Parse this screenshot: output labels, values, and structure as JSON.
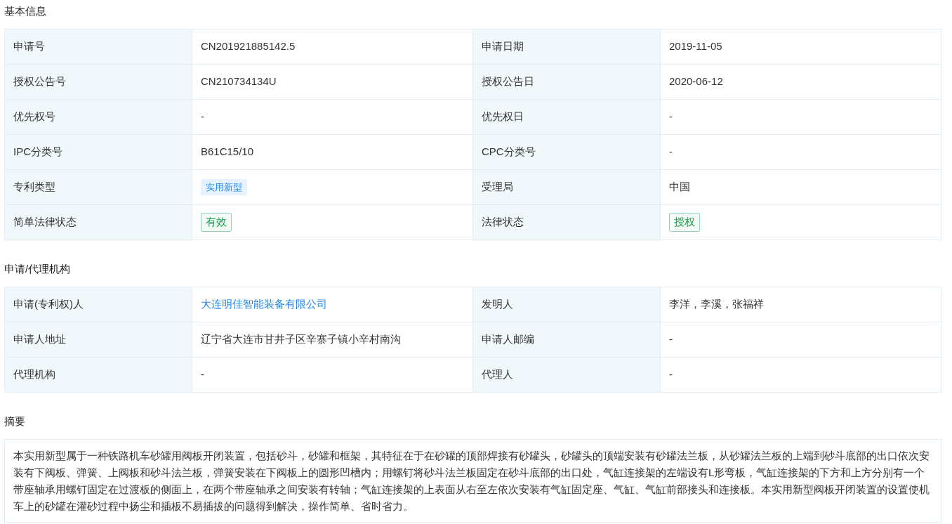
{
  "sections": [
    {
      "title": "基本信息",
      "kind": "table",
      "rows": [
        [
          {
            "label": "申请号",
            "value": "CN201921885142.5",
            "kind": "text"
          },
          {
            "label": "申请日期",
            "value": "2019-11-05",
            "kind": "text"
          }
        ],
        [
          {
            "label": "授权公告号",
            "value": "CN210734134U",
            "kind": "text"
          },
          {
            "label": "授权公告日",
            "value": "2020-06-12",
            "kind": "text"
          }
        ],
        [
          {
            "label": "优先权号",
            "value": "-",
            "kind": "text"
          },
          {
            "label": "优先权日",
            "value": "-",
            "kind": "text"
          }
        ],
        [
          {
            "label": "IPC分类号",
            "value": "B61C15/10",
            "kind": "text"
          },
          {
            "label": "CPC分类号",
            "value": "-",
            "kind": "text"
          }
        ],
        [
          {
            "label": "专利类型",
            "value": "实用新型",
            "kind": "tag"
          },
          {
            "label": "受理局",
            "value": "中国",
            "kind": "text"
          }
        ],
        [
          {
            "label": "简单法律状态",
            "value": "有效",
            "kind": "status"
          },
          {
            "label": "法律状态",
            "value": "授权",
            "kind": "status"
          }
        ]
      ]
    },
    {
      "title": "申请/代理机构",
      "kind": "table",
      "rows": [
        [
          {
            "label": "申请(专利权)人",
            "value": "大连明佳智能装备有限公司",
            "kind": "link"
          },
          {
            "label": "发明人",
            "value": "李洋，李溪，张福祥",
            "kind": "text"
          }
        ],
        [
          {
            "label": "申请人地址",
            "value": "辽宁省大连市甘井子区辛寨子镇小辛村南沟",
            "kind": "text"
          },
          {
            "label": "申请人邮编",
            "value": "-",
            "kind": "text"
          }
        ],
        [
          {
            "label": "代理机构",
            "value": "-",
            "kind": "text"
          },
          {
            "label": "代理人",
            "value": "-",
            "kind": "text"
          }
        ]
      ]
    },
    {
      "title": "摘要",
      "kind": "text",
      "text": "本实用新型属于一种铁路机车砂罐用阀板开闭装置，包括砂斗，砂罐和框架，其特征在于在砂罐的顶部焊接有砂罐头，砂罐头的顶端安装有砂罐法兰板，从砂罐法兰板的上端到砂斗底部的出口依次安装有下阀板、弹簧、上阀板和砂斗法兰板，弹簧安装在下阀板上的圆形凹槽内；用螺钉将砂斗法兰板固定在砂斗底部的出口处，气缸连接架的左端设有L形弯板，气缸连接架的下方和上方分别有一个带座轴承用螺钉固定在过渡板的侧面上，在两个带座轴承之间安装有转轴；气缸连接架的上表面从右至左依次安装有气缸固定座、气缸、气缸前部接头和连接板。本实用新型阀板开闭装置的设置使机车上的砂罐在灌砂过程中扬尘和插板不易插拔的问题得到解决，操作简单、省时省力。"
    }
  ]
}
